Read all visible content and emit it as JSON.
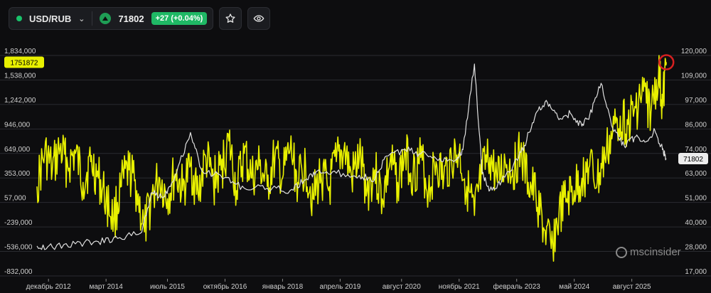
{
  "toolbar": {
    "symbol": "USD/RUB",
    "dropdown_icon": "chevron-down-icon",
    "price": "71802",
    "change": "+27 (+0.04%)",
    "favorite_icon": "star-icon",
    "view_icon": "eye-icon"
  },
  "watermark": {
    "text": "mscinsider",
    "icon": "msc-logo-icon"
  },
  "colors": {
    "background": "#0d0d0f",
    "series_left": "#e8f000",
    "series_right": "#e0e0e0",
    "positive": "#1fb865",
    "highlight_circle": "#d62020"
  },
  "chart_data": {
    "type": "line",
    "left_axis": {
      "ticks": [
        "1,834,000",
        "1,538,000",
        "1,242,000",
        "946,000",
        "649,000",
        "353,000",
        "57,000",
        "-239,000",
        "-536,000",
        "-832,000"
      ],
      "min": -832000,
      "max": 1834000
    },
    "right_axis": {
      "ticks": [
        "120,000",
        "109,000",
        "97,000",
        "86,000",
        "74,000",
        "63,000",
        "51,000",
        "40,000",
        "28,000",
        "17,000"
      ],
      "min": 17000,
      "max": 120000
    },
    "x_ticks": [
      "декабрь 2012",
      "март 2014",
      "июль 2015",
      "октябрь 2016",
      "январь 2018",
      "апрель 2019",
      "август 2020",
      "ноябрь 2021",
      "февраль 2023",
      "май 2024",
      "август 2025"
    ],
    "x_range": [
      "2012-09",
      "2026-07"
    ],
    "current_left_value": "1751872",
    "current_right_value": "71802",
    "series": [
      {
        "axis": "left",
        "color": "#e8f000",
        "points": [
          [
            "2012-09",
            250000
          ],
          [
            "2012-11",
            650000
          ],
          [
            "2013-01",
            450000
          ],
          [
            "2013-03",
            700000
          ],
          [
            "2013-05",
            500000
          ],
          [
            "2013-07",
            650000
          ],
          [
            "2013-09",
            300000
          ],
          [
            "2013-11",
            550000
          ],
          [
            "2014-01",
            350000
          ],
          [
            "2014-03",
            100000
          ],
          [
            "2014-05",
            -150000
          ],
          [
            "2014-07",
            250000
          ],
          [
            "2014-09",
            450000
          ],
          [
            "2014-11",
            200000
          ],
          [
            "2015-01",
            -300000
          ],
          [
            "2015-03",
            150000
          ],
          [
            "2015-05",
            350000
          ],
          [
            "2015-07",
            100000
          ],
          [
            "2015-09",
            400000
          ],
          [
            "2015-11",
            200000
          ],
          [
            "2016-01",
            500000
          ],
          [
            "2016-03",
            150000
          ],
          [
            "2016-05",
            600000
          ],
          [
            "2016-07",
            300000
          ],
          [
            "2016-09",
            450000
          ],
          [
            "2016-11",
            800000
          ],
          [
            "2017-01",
            200000
          ],
          [
            "2017-03",
            650000
          ],
          [
            "2017-05",
            350000
          ],
          [
            "2017-07",
            500000
          ],
          [
            "2017-09",
            250000
          ],
          [
            "2017-11",
            600000
          ],
          [
            "2018-01",
            350000
          ],
          [
            "2018-03",
            700000
          ],
          [
            "2018-05",
            300000
          ],
          [
            "2018-07",
            500000
          ],
          [
            "2018-09",
            100000
          ],
          [
            "2018-11",
            400000
          ],
          [
            "2019-01",
            200000
          ],
          [
            "2019-03",
            550000
          ],
          [
            "2019-05",
            700000
          ],
          [
            "2019-07",
            350000
          ],
          [
            "2019-09",
            600000
          ],
          [
            "2019-11",
            200000
          ],
          [
            "2020-01",
            450000
          ],
          [
            "2020-03",
            100000
          ],
          [
            "2020-05",
            550000
          ],
          [
            "2020-07",
            300000
          ],
          [
            "2020-09",
            650000
          ],
          [
            "2020-11",
            400000
          ],
          [
            "2021-01",
            600000
          ],
          [
            "2021-03",
            200000
          ],
          [
            "2021-05",
            550000
          ],
          [
            "2021-07",
            350000
          ],
          [
            "2021-09",
            600000
          ],
          [
            "2021-11",
            650000
          ],
          [
            "2022-01",
            250000
          ],
          [
            "2022-03",
            -100000
          ],
          [
            "2022-05",
            400000
          ],
          [
            "2022-07",
            600000
          ],
          [
            "2022-09",
            300000
          ],
          [
            "2022-11",
            550000
          ],
          [
            "2023-01",
            450000
          ],
          [
            "2023-03",
            650000
          ],
          [
            "2023-05",
            300000
          ],
          [
            "2023-07",
            150000
          ],
          [
            "2023-09",
            -250000
          ],
          [
            "2023-11",
            -500000
          ],
          [
            "2024-01",
            -100000
          ],
          [
            "2024-03",
            100000
          ],
          [
            "2024-05",
            200000
          ],
          [
            "2024-07",
            350000
          ],
          [
            "2024-09",
            500000
          ],
          [
            "2024-11",
            300000
          ],
          [
            "2025-01",
            600000
          ],
          [
            "2025-03",
            900000
          ],
          [
            "2025-05",
            1100000
          ],
          [
            "2025-07",
            1000000
          ],
          [
            "2025-09",
            1200000
          ],
          [
            "2025-11",
            1400000
          ],
          [
            "2026-01",
            1150000
          ],
          [
            "2026-03",
            1650000
          ],
          [
            "2026-04",
            1200000
          ],
          [
            "2026-05",
            1751872
          ]
        ]
      },
      {
        "axis": "right",
        "color": "#e0e0e0",
        "points": [
          [
            "2012-09",
            31000
          ],
          [
            "2013-01",
            30500
          ],
          [
            "2013-07",
            32000
          ],
          [
            "2014-01",
            33000
          ],
          [
            "2014-06",
            34500
          ],
          [
            "2014-12",
            37000
          ],
          [
            "2015-03",
            56000
          ],
          [
            "2015-06",
            54000
          ],
          [
            "2015-09",
            64000
          ],
          [
            "2016-01",
            84000
          ],
          [
            "2016-04",
            66000
          ],
          [
            "2016-10",
            63000
          ],
          [
            "2017-03",
            58000
          ],
          [
            "2017-09",
            58000
          ],
          [
            "2018-03",
            57000
          ],
          [
            "2018-07",
            62000
          ],
          [
            "2018-10",
            66000
          ],
          [
            "2019-03",
            65000
          ],
          [
            "2019-09",
            64000
          ],
          [
            "2020-01",
            62000
          ],
          [
            "2020-04",
            73000
          ],
          [
            "2020-09",
            76000
          ],
          [
            "2021-01",
            74000
          ],
          [
            "2021-06",
            72000
          ],
          [
            "2021-10",
            71000
          ],
          [
            "2021-12",
            76000
          ],
          [
            "2022-03",
            116000
          ],
          [
            "2022-05",
            65000
          ],
          [
            "2022-07",
            57000
          ],
          [
            "2022-10",
            61000
          ],
          [
            "2023-01",
            68000
          ],
          [
            "2023-04",
            78000
          ],
          [
            "2023-07",
            93000
          ],
          [
            "2023-10",
            98000
          ],
          [
            "2024-01",
            90000
          ],
          [
            "2024-04",
            93000
          ],
          [
            "2024-07",
            87000
          ],
          [
            "2024-09",
            92000
          ],
          [
            "2024-12",
            107000
          ],
          [
            "2025-03",
            86000
          ],
          [
            "2025-06",
            78000
          ],
          [
            "2025-09",
            82000
          ],
          [
            "2025-12",
            80000
          ],
          [
            "2026-02",
            85000
          ],
          [
            "2026-04",
            76000
          ],
          [
            "2026-05",
            71802
          ]
        ]
      }
    ],
    "highlight": {
      "x": "2026-05",
      "axis": "left",
      "value": 1751872
    }
  }
}
